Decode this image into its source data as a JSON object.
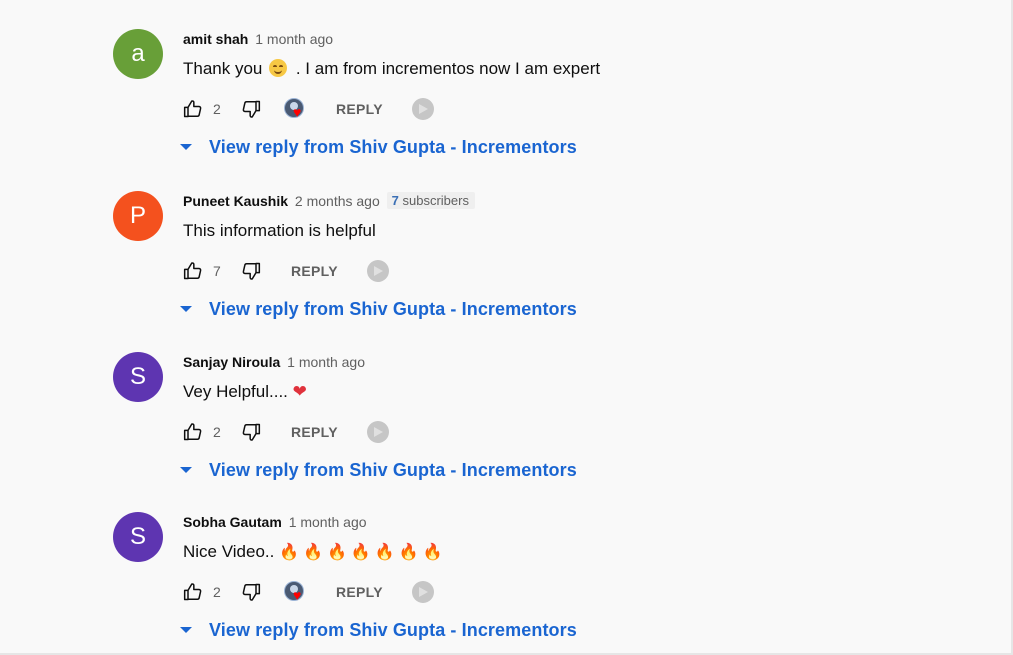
{
  "colors": {
    "link_blue": "#1a65d1",
    "avatar_green": "#689f38",
    "avatar_orange": "#f4511e",
    "avatar_purple": "#5e35b1",
    "heart_red": "#ff0000"
  },
  "comments": [
    {
      "author": "amit shah",
      "time": "1 month ago",
      "avatar_letter": "a",
      "text_before": "Thank you",
      "text_after": " .  I am from incrementos now I am expert",
      "likes": "2",
      "reply_label": "REPLY",
      "view_reply": "View reply from Shiv Gupta - Incrementors"
    },
    {
      "author": "Puneet Kaushik",
      "time": "2 months ago",
      "subs_count": "7",
      "subs_label": " subscribers",
      "avatar_letter": "P",
      "text": "This information is helpful",
      "likes": "7",
      "reply_label": "REPLY",
      "view_reply": "View reply from Shiv Gupta - Incrementors"
    },
    {
      "author": "Sanjay Niroula",
      "time": "1 month ago",
      "avatar_letter": "S",
      "text": "Vey Helpful....",
      "heart": "❤",
      "likes": "2",
      "reply_label": "REPLY",
      "view_reply": "View reply from Shiv Gupta - Incrementors"
    },
    {
      "author": "Sobha Gautam",
      "time": "1 month ago",
      "avatar_letter": "S",
      "text": "Nice Video..",
      "fire": "🔥",
      "likes": "2",
      "reply_label": "REPLY",
      "view_reply": "View reply from Shiv Gupta - Incrementors"
    }
  ],
  "icons": {
    "like": "thumbs-up-icon",
    "dislike": "thumbs-down-icon",
    "creator_heart": "creator-heart-icon",
    "caret": "caret-down-icon",
    "promo": "promote-icon"
  }
}
